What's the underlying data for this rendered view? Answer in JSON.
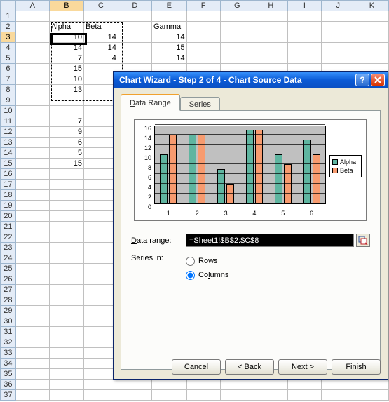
{
  "columns": [
    "A",
    "B",
    "C",
    "D",
    "E",
    "F",
    "G",
    "H",
    "I",
    "J",
    "K"
  ],
  "rows": [
    1,
    2,
    3,
    4,
    5,
    6,
    7,
    8,
    9,
    10,
    11,
    12,
    13,
    14,
    15,
    16,
    17,
    18,
    19,
    20,
    21,
    22,
    23,
    24,
    25,
    26,
    27,
    28,
    29,
    30,
    31,
    32,
    33,
    34,
    35,
    36,
    37
  ],
  "cells": {
    "B2": "Alpha",
    "C2": "Beta",
    "E2": "Gamma",
    "B3": "10",
    "C3": "14",
    "E3": "14",
    "B4": "14",
    "C4": "14",
    "E4": "15",
    "B5": "7",
    "C5": "4",
    "E5": "14",
    "B6": "15",
    "B7": "10",
    "B8": "13",
    "B11": "7",
    "B12": "9",
    "B13": "6",
    "B14": "5",
    "B15": "15"
  },
  "selected_cell": "B3",
  "marching_range": "B2:C8",
  "dialog": {
    "title": "Chart Wizard - Step 2 of 4 - Chart Source Data",
    "tabs": [
      {
        "label": "Data Range",
        "active": true
      },
      {
        "label": "Series",
        "active": false
      }
    ],
    "data_range_label": "Data range:",
    "data_range_value": "=Sheet1!$B$2:$C$8",
    "series_in_label": "Series in:",
    "series_in_options": [
      "Rows",
      "Columns"
    ],
    "series_in_value": "Columns",
    "buttons": {
      "cancel": "Cancel",
      "back": "< Back",
      "next": "Next >",
      "finish": "Finish"
    }
  },
  "chart_data": {
    "type": "bar",
    "categories": [
      "1",
      "2",
      "3",
      "4",
      "5",
      "6"
    ],
    "series": [
      {
        "name": "Alpha",
        "color": "#5fb5a0",
        "values": [
          10,
          14,
          7,
          15,
          10,
          13
        ]
      },
      {
        "name": "Beta",
        "color": "#f79b6f",
        "values": [
          14,
          14,
          4,
          15,
          8,
          10
        ]
      }
    ],
    "yticks": [
      0,
      2,
      4,
      6,
      8,
      10,
      12,
      14,
      16
    ],
    "ylim": [
      0,
      16
    ],
    "title": "",
    "xlabel": "",
    "ylabel": ""
  }
}
